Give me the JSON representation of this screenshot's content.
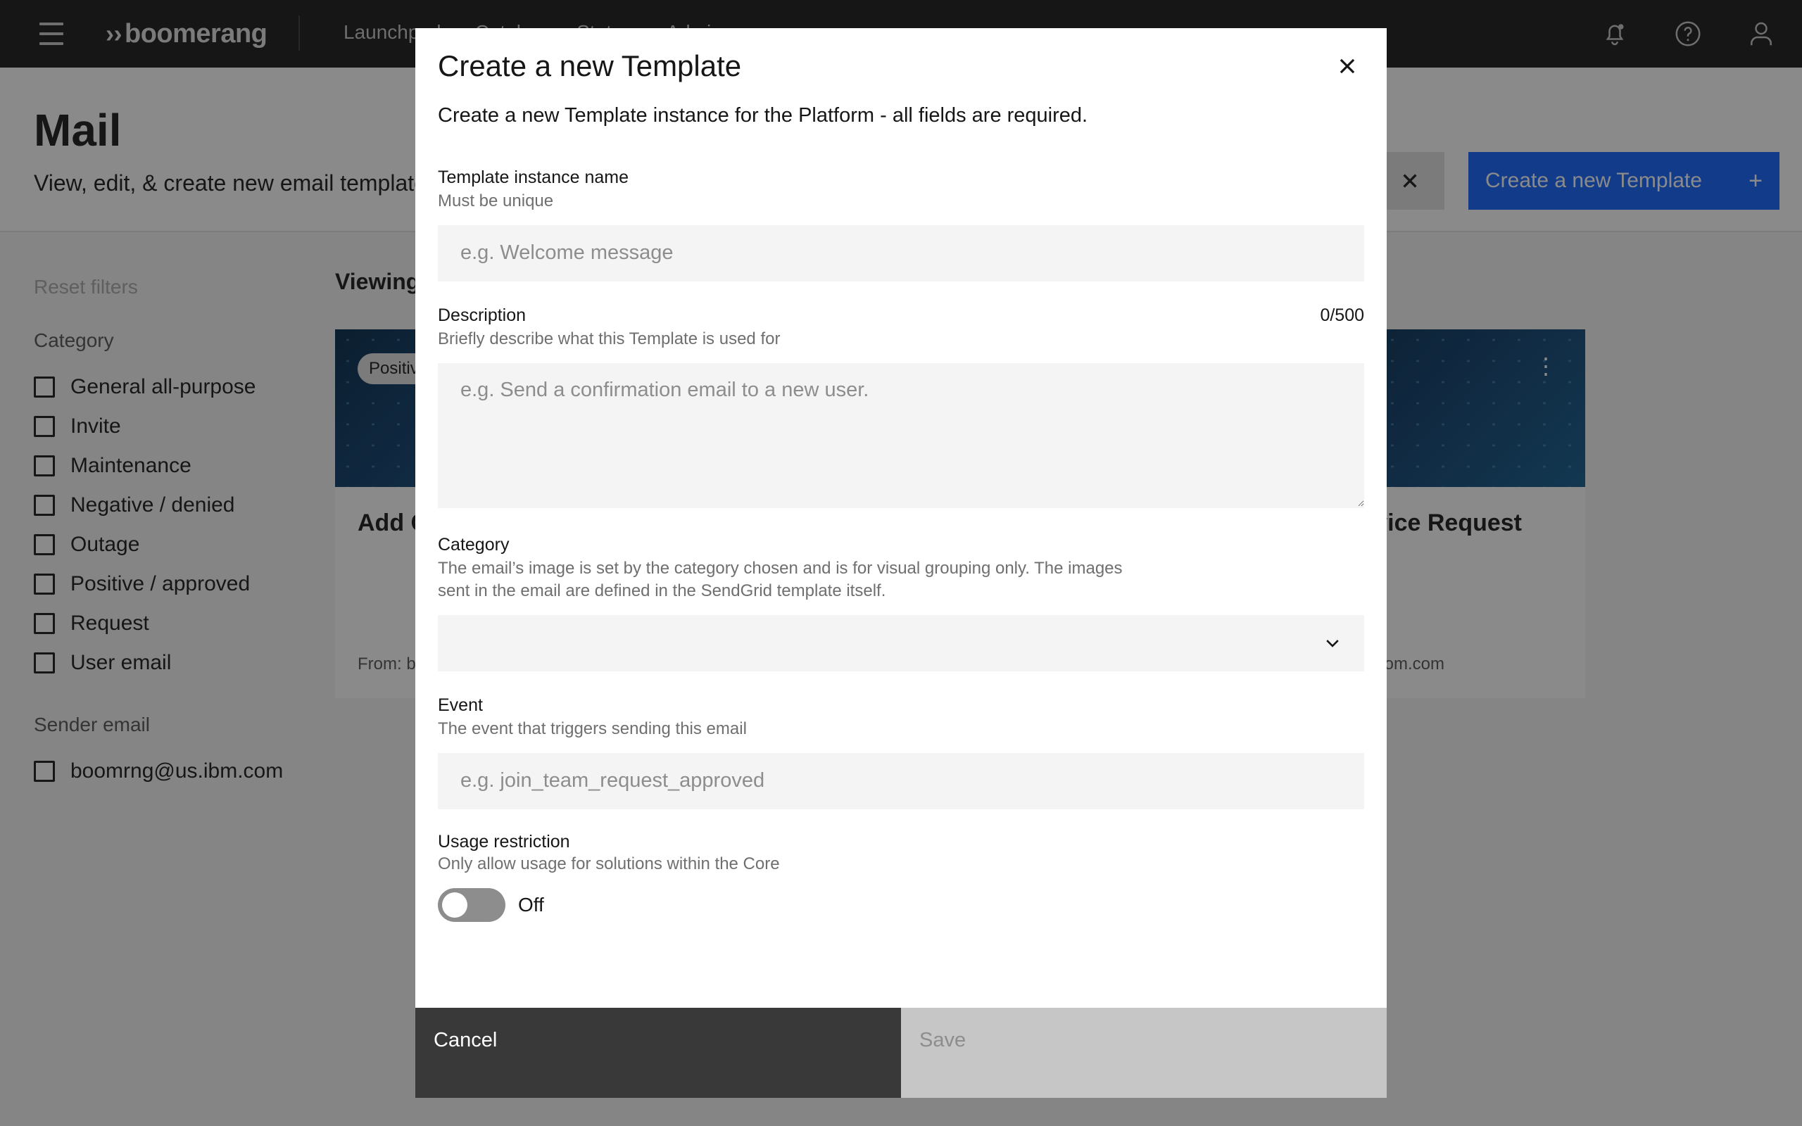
{
  "header": {
    "brand": "boomerang",
    "nav": [
      "Launchpad",
      "Catalog",
      "Status",
      "Admin"
    ],
    "icons": [
      "notification-icon",
      "help-icon",
      "user-icon"
    ]
  },
  "page": {
    "title": "Mail",
    "subtitle": "View, edit, & create new email templates",
    "create_button": "Create a new Template",
    "create_icon": "+"
  },
  "filters": {
    "reset": "Reset filters",
    "category_title": "Category",
    "categories": [
      "General all-purpose",
      "Invite",
      "Maintenance",
      "Negative / denied",
      "Outage",
      "Positive / approved",
      "Request",
      "User email"
    ],
    "sender_title": "Sender email",
    "senders": [
      "boomrng@us.ibm.com"
    ]
  },
  "main": {
    "viewing": "Viewing",
    "cards": [
      {
        "tag": "Positive",
        "title": "Add C",
        "from": "From: b"
      },
      {
        "tag": "",
        "title": "vice Request",
        "from": "om.com"
      }
    ]
  },
  "modal": {
    "title": "Create a new Template",
    "description": "Create a new Template instance for the Platform - all fields are required.",
    "name": {
      "label": "Template instance name",
      "help": "Must be unique",
      "placeholder": "e.g. Welcome message",
      "value": ""
    },
    "description_field": {
      "label": "Description",
      "help": "Briefly describe what this Template is used for",
      "placeholder": "e.g. Send a confirmation email to a new user.",
      "counter": "0/500",
      "value": ""
    },
    "category": {
      "label": "Category",
      "help": "The email’s image is set by the category chosen and is for visual grouping only. The images sent in the email are defined in the SendGrid template itself.",
      "value": ""
    },
    "event": {
      "label": "Event",
      "help": "The event that triggers sending this email",
      "placeholder": "e.g. join_team_request_approved",
      "value": ""
    },
    "usage": {
      "label": "Usage restriction",
      "help": "Only allow usage for solutions within the Core",
      "toggle_text": "Off",
      "enabled": false
    },
    "buttons": {
      "cancel": "Cancel",
      "save": "Save"
    }
  },
  "colors": {
    "header_bg": "#161616",
    "primary": "#0f62fe",
    "cancel_bg": "#393939",
    "save_disabled_bg": "#c6c6c6"
  }
}
